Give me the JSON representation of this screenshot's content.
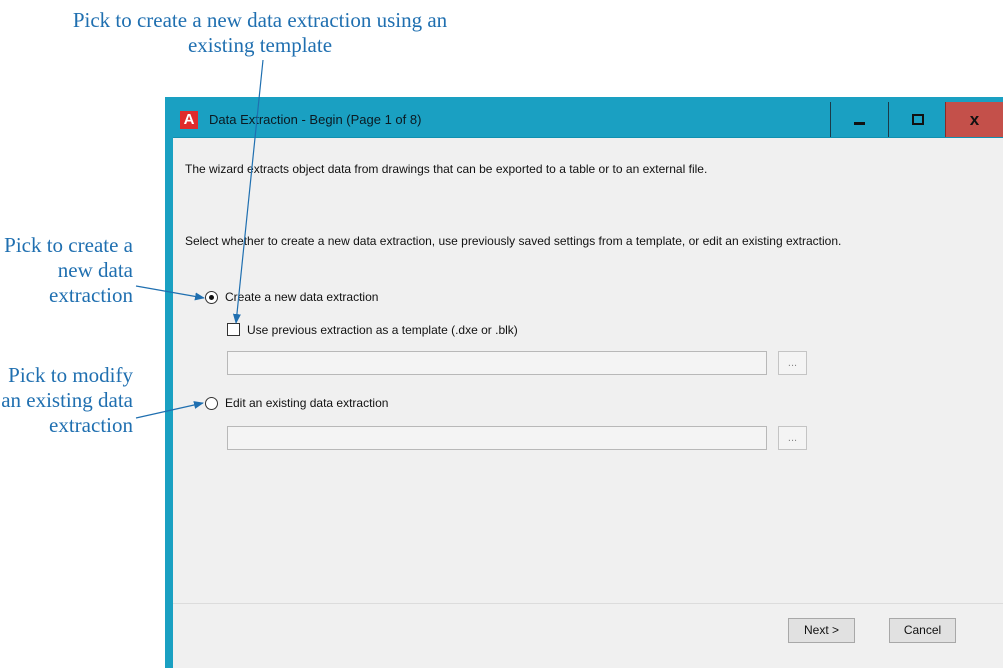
{
  "callouts": {
    "top": "Pick to create a new data extraction using an existing template",
    "new_extraction": "Pick to create a new data extraction",
    "edit_extraction": "Pick to modify an existing data extraction"
  },
  "window": {
    "app_icon": "A",
    "title": "Data Extraction - Begin (Page 1 of 8)"
  },
  "content": {
    "intro": "The wizard extracts object data from drawings that can be exported to a table or to an external file.",
    "select_prompt": "Select whether to create a new data extraction, use previously saved settings from a template, or edit an existing extraction.",
    "create_new_label": "Create a new data extraction",
    "use_template_label": "Use previous extraction as a template (.dxe or .blk)",
    "edit_existing_label": "Edit an existing data extraction",
    "browse_label": "...",
    "template_path_value": "",
    "edit_path_value": ""
  },
  "footer": {
    "next_label": "Next >",
    "cancel_label": "Cancel"
  },
  "colors": {
    "titlebar": "#1aa0c2",
    "close_button": "#c4504a",
    "callout_text": "#1f6fb0"
  }
}
